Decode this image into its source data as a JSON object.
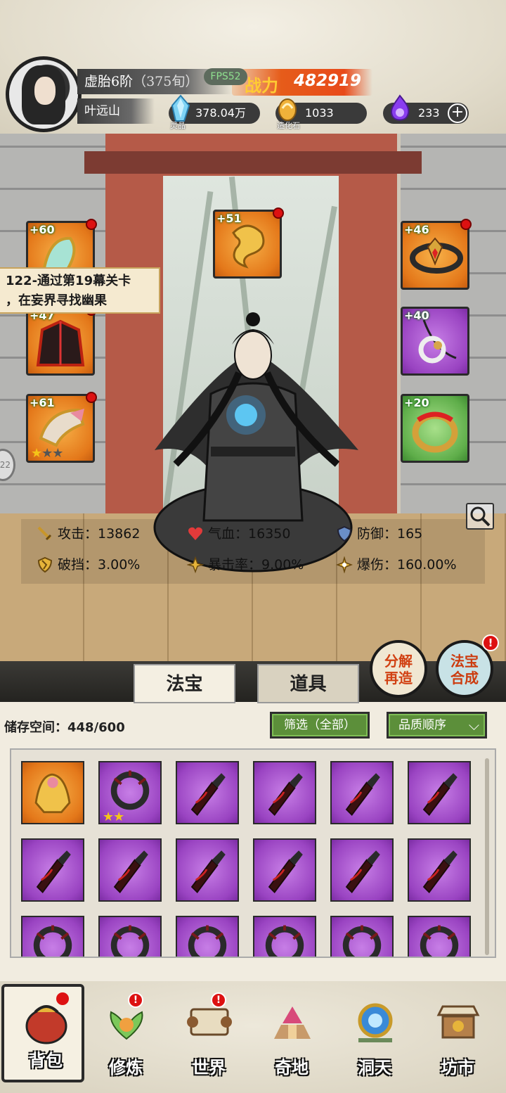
{
  "player": {
    "realm": "虚胎6阶",
    "realm_sub": "（375旬）",
    "name": "叶远山",
    "fps": "FPS52",
    "power_label": "战力",
    "power_value": "482919"
  },
  "resources": [
    {
      "icon": "spirit-crystal-icon",
      "label": "灵晶",
      "value": "378.04万"
    },
    {
      "icon": "creation-stone-icon",
      "label": "造化石",
      "value": "1033"
    },
    {
      "icon": "purple-flame-icon",
      "label": "",
      "value": "233"
    }
  ],
  "add_button": "+",
  "quest_tip": [
    "122-通过第19幕关卡",
    "，在妄界寻找幽果"
  ],
  "side_button": "22",
  "equipment": [
    {
      "level": "+60",
      "quality": "orange",
      "icon": "jade-talisman-icon",
      "alert": true
    },
    {
      "level": "+47",
      "quality": "orange",
      "icon": "robe-armor-icon",
      "alert": true
    },
    {
      "level": "+61",
      "quality": "orange",
      "icon": "gauntlet-icon",
      "alert": true,
      "stars_on": 1,
      "stars_total": 3
    },
    {
      "level": "+51",
      "quality": "orange",
      "icon": "dragon-emblem-icon",
      "alert": true
    },
    {
      "level": "+46",
      "quality": "orange",
      "icon": "crown-circlet-icon",
      "alert": true
    },
    {
      "level": "+40",
      "quality": "purple",
      "icon": "pendant-necklace-icon",
      "alert": false
    },
    {
      "level": "+20",
      "quality": "green",
      "icon": "gold-ring-icon",
      "alert": false
    }
  ],
  "stats": [
    {
      "icon": "sword-icon",
      "label": "攻击：13862"
    },
    {
      "icon": "heart-icon",
      "label": "气血：16350"
    },
    {
      "icon": "shield-icon",
      "label": "防御：165"
    },
    {
      "icon": "armor-break-icon",
      "label": "破挡：3.00%"
    },
    {
      "icon": "crit-rate-icon",
      "label": "暴击率：9.00%"
    },
    {
      "icon": "crit-damage-icon",
      "label": "爆伤：160.00%"
    }
  ],
  "round_buttons": {
    "decompose": [
      "分解",
      "再造"
    ],
    "combine": [
      "法宝",
      "合成"
    ],
    "alert": "!"
  },
  "tabs": [
    "法宝",
    "道具"
  ],
  "storage": "储存空间：448/600",
  "filter_label": "筛选（全部）",
  "sort_label": "品质顺序",
  "inventory": [
    {
      "quality": "orange",
      "icon": "golden-armor-icon",
      "stars": 0
    },
    {
      "quality": "purple",
      "icon": "dark-ring-icon",
      "stars": 2
    },
    {
      "quality": "purple",
      "icon": "dark-dagger-icon",
      "stars": 0
    },
    {
      "quality": "purple",
      "icon": "dark-dagger-icon",
      "stars": 0
    },
    {
      "quality": "purple",
      "icon": "dark-dagger-icon",
      "stars": 0
    },
    {
      "quality": "purple",
      "icon": "dark-dagger-icon",
      "stars": 0
    },
    {
      "quality": "purple",
      "icon": "dark-dagger-icon",
      "stars": 0
    },
    {
      "quality": "purple",
      "icon": "dark-dagger-icon",
      "stars": 0
    },
    {
      "quality": "purple",
      "icon": "dark-dagger-icon",
      "stars": 0
    },
    {
      "quality": "purple",
      "icon": "dark-dagger-icon",
      "stars": 0
    },
    {
      "quality": "purple",
      "icon": "dark-dagger-icon",
      "stars": 0
    },
    {
      "quality": "purple",
      "icon": "dark-dagger-icon",
      "stars": 0
    },
    {
      "quality": "purple",
      "icon": "dark-ring-icon",
      "stars": 0
    },
    {
      "quality": "purple",
      "icon": "dark-ring-icon",
      "stars": 0
    },
    {
      "quality": "purple",
      "icon": "dark-ring-icon",
      "stars": 0
    },
    {
      "quality": "purple",
      "icon": "dark-ring-icon",
      "stars": 0
    },
    {
      "quality": "purple",
      "icon": "dark-ring-icon",
      "stars": 0
    },
    {
      "quality": "purple",
      "icon": "dark-ring-icon",
      "stars": 0
    }
  ],
  "nav": [
    {
      "label": "背包",
      "icon": "bag-icon",
      "alert": false,
      "badge": true,
      "active": true
    },
    {
      "label": "修炼",
      "icon": "lotus-icon",
      "alert": true,
      "badge": false
    },
    {
      "label": "世界",
      "icon": "scroll-map-icon",
      "alert": true,
      "badge": false
    },
    {
      "label": "奇地",
      "icon": "pavilion-icon",
      "alert": false,
      "badge": false
    },
    {
      "label": "洞天",
      "icon": "portal-icon",
      "alert": false,
      "badge": false
    },
    {
      "label": "坊市",
      "icon": "market-stall-icon",
      "alert": false,
      "badge": false
    }
  ],
  "colors": {
    "orange_quality": "#e4781a",
    "purple_quality": "#9a44c2",
    "green_quality": "#5fae4a",
    "button_green": "#5c8f3a",
    "power_bg": "#e84a1a",
    "alert_red": "#dd1111"
  }
}
